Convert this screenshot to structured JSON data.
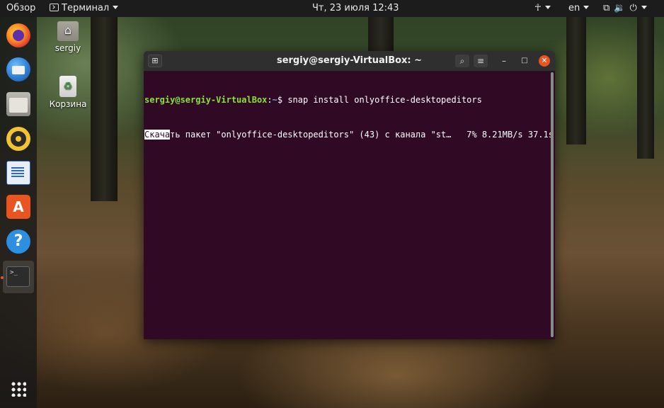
{
  "topbar": {
    "activities": "Обзор",
    "app_menu": "Терминал",
    "clock": "Чт, 23 июля  12:43",
    "language": "en"
  },
  "dock": {
    "items": [
      {
        "name": "firefox-icon"
      },
      {
        "name": "thunderbird-icon"
      },
      {
        "name": "files-icon"
      },
      {
        "name": "rhythmbox-icon"
      },
      {
        "name": "libreoffice-writer-icon"
      },
      {
        "name": "ubuntu-software-icon"
      },
      {
        "name": "help-icon"
      },
      {
        "name": "terminal-icon"
      },
      {
        "name": "show-applications-icon"
      }
    ],
    "terminal_glyph": ">_"
  },
  "desktop": {
    "home_label": "sergiy",
    "trash_label": "Корзина"
  },
  "terminal": {
    "title": "sergiy@sergiy-VirtualBox: ~",
    "prompt_user": "sergiy@sergiy-VirtualBox",
    "prompt_sep": ":",
    "prompt_path": "~",
    "prompt_symbol": "$ ",
    "command": "snap install onlyoffice-desktopeditors",
    "output_highlight": "Скача",
    "output_rest": "ть пакет \"onlyoffice-desktopeditors\" (43) с канала \"st…   7% 8.21MB/s 37.1s"
  }
}
